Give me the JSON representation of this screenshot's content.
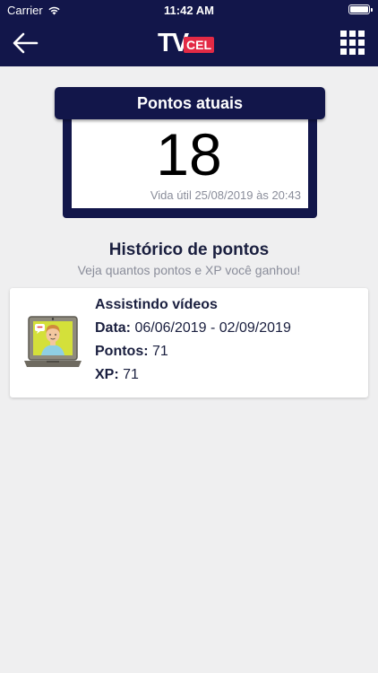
{
  "status_bar": {
    "carrier": "Carrier",
    "time": "11:42 AM"
  },
  "nav": {
    "logo_main": "TV",
    "logo_badge": "CEL",
    "back_icon": "arrow-left-icon",
    "menu_icon": "grid-menu-icon"
  },
  "points": {
    "header": "Pontos atuais",
    "value": "18",
    "expiry": "Vida útil 25/08/2019 às 20:43"
  },
  "history": {
    "title": "Histórico de pontos",
    "subtitle": "Veja quantos pontos e XP você ganhou!",
    "items": [
      {
        "icon": "laptop-person-icon",
        "title": "Assistindo vídeos",
        "date_label": "Data:",
        "date_value": "06/06/2019 - 02/09/2019",
        "points_label": "Pontos:",
        "points_value": "71",
        "xp_label": "XP:",
        "xp_value": "71"
      }
    ]
  },
  "colors": {
    "navy": "#12164a",
    "accent_red": "#e32a45",
    "background": "#efeff0"
  }
}
